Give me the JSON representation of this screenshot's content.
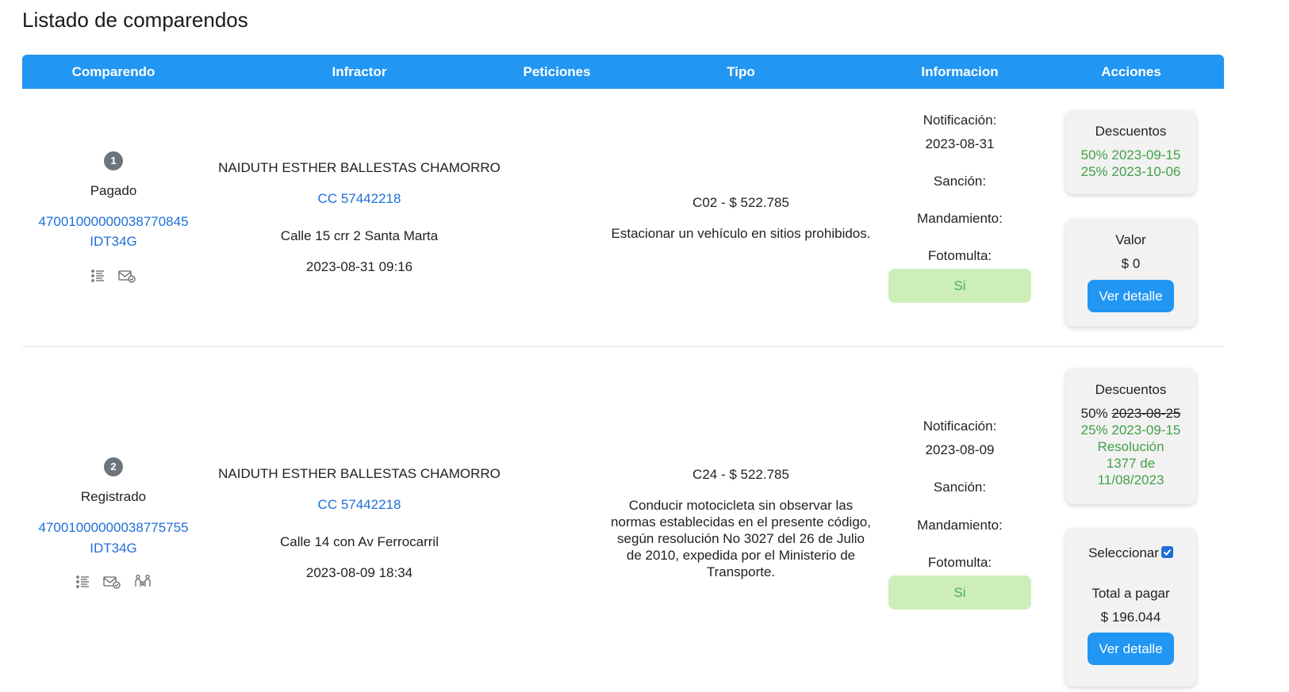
{
  "page": {
    "title": "Listado de comparendos"
  },
  "table": {
    "headers": [
      "Comparendo",
      "Infractor",
      "Peticiones",
      "Tipo",
      "Informacion",
      "Acciones"
    ]
  },
  "labels": {
    "notificacion": "Notificación:",
    "sancion": "Sanción:",
    "mandamiento": "Mandamiento:",
    "fotomulta": "Fotomulta:",
    "descuentos": "Descuentos",
    "valor": "Valor",
    "seleccionar": "Seleccionar",
    "total_a_pagar": "Total a pagar",
    "ver_detalle": "Ver detalle"
  },
  "rows": [
    {
      "index": "1",
      "status": "Pagado",
      "number": "47001000000038770845",
      "code": "IDT34G",
      "icons": [
        "list-icon",
        "mail-check-icon"
      ],
      "infractor_name": "NAIDUTH ESTHER BALLESTAS CHAMORRO",
      "document": "CC 57442218",
      "address": "Calle 15 crr 2 Santa Marta",
      "datetime": "2023-08-31 09:16",
      "tipo_code": "C02 - $ 522.785",
      "tipo_desc_lines": [
        "Estacionar un vehículo en sitios prohibidos."
      ],
      "notificacion_date": "2023-08-31",
      "fotomulta": "Si",
      "discount_lines": [
        {
          "text": "50% 2023-09-15",
          "style": "green"
        },
        {
          "text": "25% 2023-10-06",
          "style": "green"
        }
      ],
      "valor": "$ 0"
    },
    {
      "index": "2",
      "status": "Registrado",
      "number": "47001000000038775755",
      "code": "IDT34G",
      "icons": [
        "list-icon",
        "mail-check-icon",
        "people-icon"
      ],
      "infractor_name": "NAIDUTH ESTHER BALLESTAS CHAMORRO",
      "document": "CC 57442218",
      "address": "Calle 14 con Av Ferrocarril",
      "datetime": "2023-08-09 18:34",
      "tipo_code": "C24 - $ 522.785",
      "tipo_desc_lines": [
        "Conducir motocicleta sin observar las",
        "normas establecidas en el presente código,",
        "según resolución No 3027 del 26 de Julio",
        "de 2010, expedida por el Ministerio de",
        "Transporte."
      ],
      "notificacion_date": "2023-08-09",
      "fotomulta": "Si",
      "discount_line1_prefix": "50% ",
      "discount_line1_struck": "2023-08-25",
      "discount_lines_green": [
        "25% 2023-09-15",
        "Resolución",
        "1377 de",
        "11/08/2023"
      ],
      "seleccionar_checked": true,
      "total": "$ 196.044"
    }
  ],
  "colors": {
    "primary": "#2196f3",
    "link": "#1e6fd9",
    "green": "#43a047",
    "pill_bg": "#cdeeb9",
    "badge": "#6c757d"
  }
}
